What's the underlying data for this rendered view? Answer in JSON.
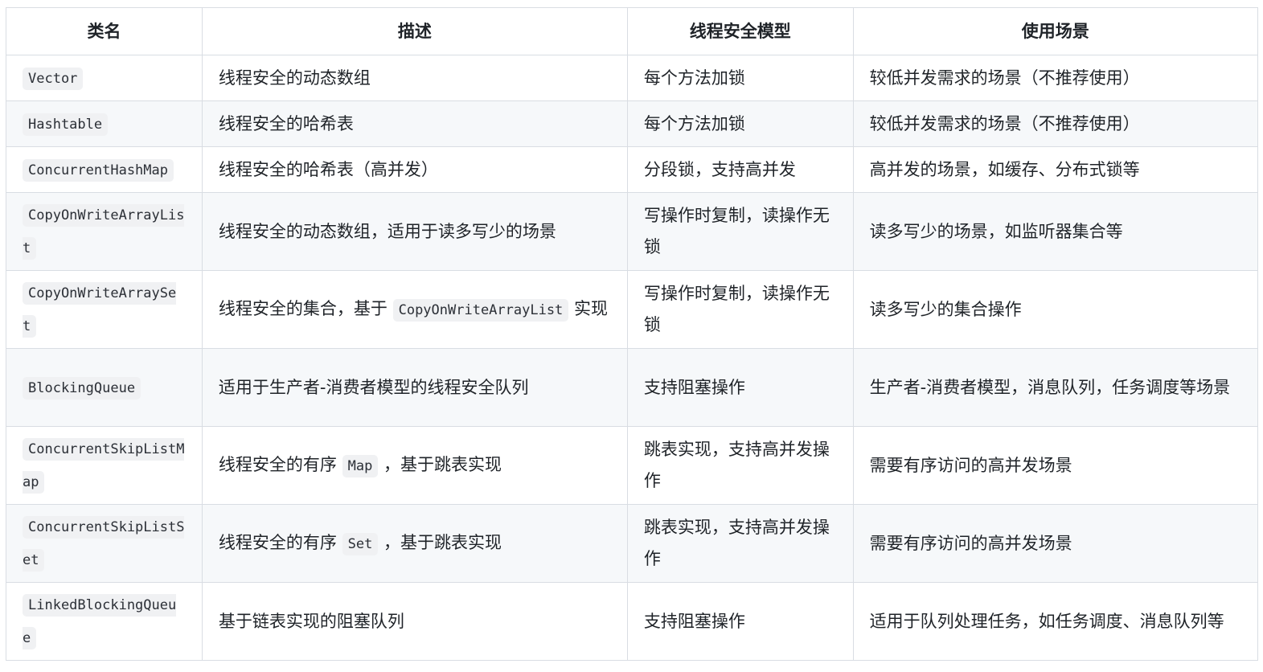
{
  "table": {
    "headers": [
      "类名",
      "描述",
      "线程安全模型",
      "使用场景"
    ],
    "rows": [
      {
        "name": "Vector",
        "description": [
          {
            "text": "线程安全的动态数组"
          }
        ],
        "model": "每个方法加锁",
        "scenario": "较低并发需求的场景（不推荐使用）"
      },
      {
        "name": "Hashtable",
        "description": [
          {
            "text": "线程安全的哈希表"
          }
        ],
        "model": "每个方法加锁",
        "scenario": "较低并发需求的场景（不推荐使用）"
      },
      {
        "name": "ConcurrentHashMap",
        "description": [
          {
            "text": "线程安全的哈希表（高并发）"
          }
        ],
        "model": "分段锁，支持高并发",
        "scenario": "高并发的场景，如缓存、分布式锁等"
      },
      {
        "name": "CopyOnWriteArrayList",
        "description": [
          {
            "text": "线程安全的动态数组，适用于读多写少的场景"
          }
        ],
        "model": "写操作时复制，读操作无锁",
        "scenario": "读多写少的场景，如监听器集合等"
      },
      {
        "name": "CopyOnWriteArraySet",
        "description": [
          {
            "text": "线程安全的集合，基于 "
          },
          {
            "code": "CopyOnWriteArrayList"
          },
          {
            "text": " 实现"
          }
        ],
        "model": "写操作时复制，读操作无锁",
        "scenario": "读多写少的集合操作"
      },
      {
        "name": "BlockingQueue",
        "description": [
          {
            "text": "适用于生产者-消费者模型的线程安全队列"
          }
        ],
        "model": "支持阻塞操作",
        "scenario": "生产者-消费者模型，消息队列，任务调度等场景"
      },
      {
        "name": "ConcurrentSkipListMap",
        "description": [
          {
            "text": "线程安全的有序 "
          },
          {
            "code": "Map"
          },
          {
            "text": " ，基于跳表实现"
          }
        ],
        "model": "跳表实现，支持高并发操作",
        "scenario": "需要有序访问的高并发场景"
      },
      {
        "name": "ConcurrentSkipListSet",
        "description": [
          {
            "text": "线程安全的有序 "
          },
          {
            "code": "Set"
          },
          {
            "text": " ，基于跳表实现"
          }
        ],
        "model": "跳表实现，支持高并发操作",
        "scenario": "需要有序访问的高并发场景"
      },
      {
        "name": "LinkedBlockingQueue",
        "description": [
          {
            "text": "基于链表实现的阻塞队列"
          }
        ],
        "model": "支持阻塞操作",
        "scenario": "适用于队列处理任务，如任务调度、消息队列等"
      }
    ]
  },
  "colors": {
    "border": "#d9dde3",
    "stripe": "#f6f8fa",
    "code_bg": "#f0f1f3",
    "text": "#1f2328"
  }
}
